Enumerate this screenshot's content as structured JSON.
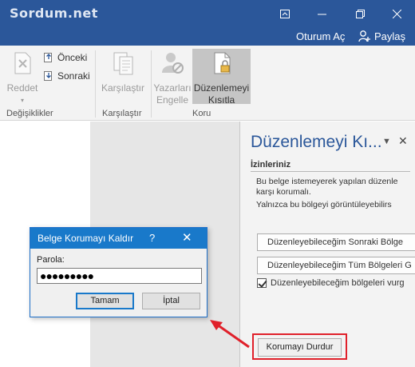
{
  "watermark": "Sordum.net",
  "window": {
    "ribbon_display_icon": "ribbon-display-options-icon",
    "minimize_icon": "minimize-icon",
    "restore_icon": "restore-icon",
    "close_icon": "close-icon"
  },
  "account": {
    "signin_label": "Oturum Aç",
    "share_label": "Paylaş"
  },
  "ribbon": {
    "reject_label": "Reddet",
    "previous_label": "Önceki",
    "next_label": "Sonraki",
    "changes_group": "Değişiklikler",
    "compare_label": "Karşılaştır",
    "compare_group": "Karşılaştır",
    "block_authors_line1": "Yazarları",
    "block_authors_line2": "Engelle",
    "restrict_line1": "Düzenlemeyi",
    "restrict_line2": "Kısıtla",
    "protect_group": "Koru"
  },
  "pane": {
    "title": "Düzenlemeyi Kı...",
    "permissions_header": "İzinleriniz",
    "desc_line1": "Bu belge istemeyerek yapılan düzenle",
    "desc_line2": "karşı korumalı.",
    "desc_line3": "Yalnızca bu bölgeyi görüntüleyebilirs",
    "find_next_label": "Düzenleyebileceğim Sonraki Bölge",
    "show_all_label": "Düzenleyebileceğim Tüm Bölgeleri G",
    "highlight_label": "Düzenleyebileceğim bölgeleri vurg",
    "highlight_checked": true,
    "stop_protection_label": "Korumayı Durdur"
  },
  "dialog": {
    "title": "Belge Korumayı Kaldır",
    "help_label": "?",
    "password_label": "Parola:",
    "password_value": "●●●●●●●●●",
    "ok_label": "Tamam",
    "cancel_label": "İptal"
  },
  "accent": "#2b579a",
  "highlight_color": "#e0202a"
}
